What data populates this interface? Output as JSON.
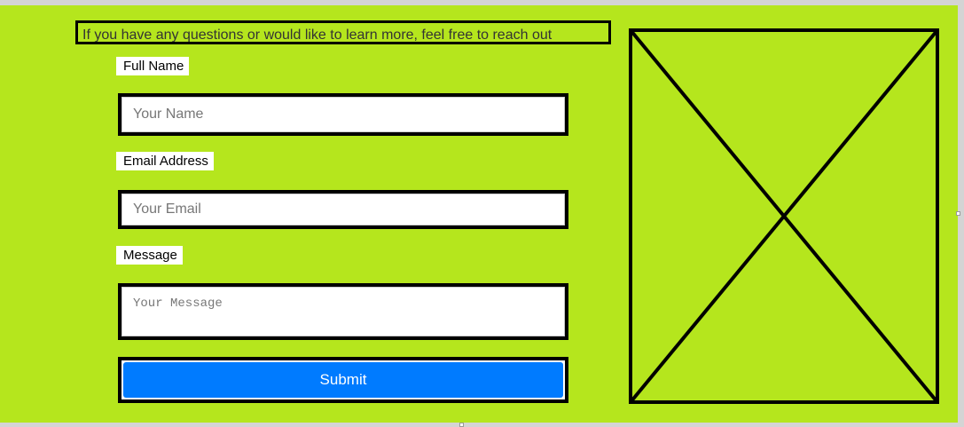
{
  "intro": {
    "text": "If you have any questions or would like to learn more, feel free to reach out"
  },
  "form": {
    "name": {
      "label": "Full Name",
      "placeholder": "Your Name"
    },
    "email": {
      "label": "Email Address",
      "placeholder": "Your Email"
    },
    "message": {
      "label": "Message",
      "placeholder": "Your Message"
    },
    "submit_label": "Submit"
  },
  "colors": {
    "background": "#b5e61d",
    "submit": "#007bff"
  },
  "image_placeholder": {
    "icon": "image-placeholder-x-icon"
  }
}
